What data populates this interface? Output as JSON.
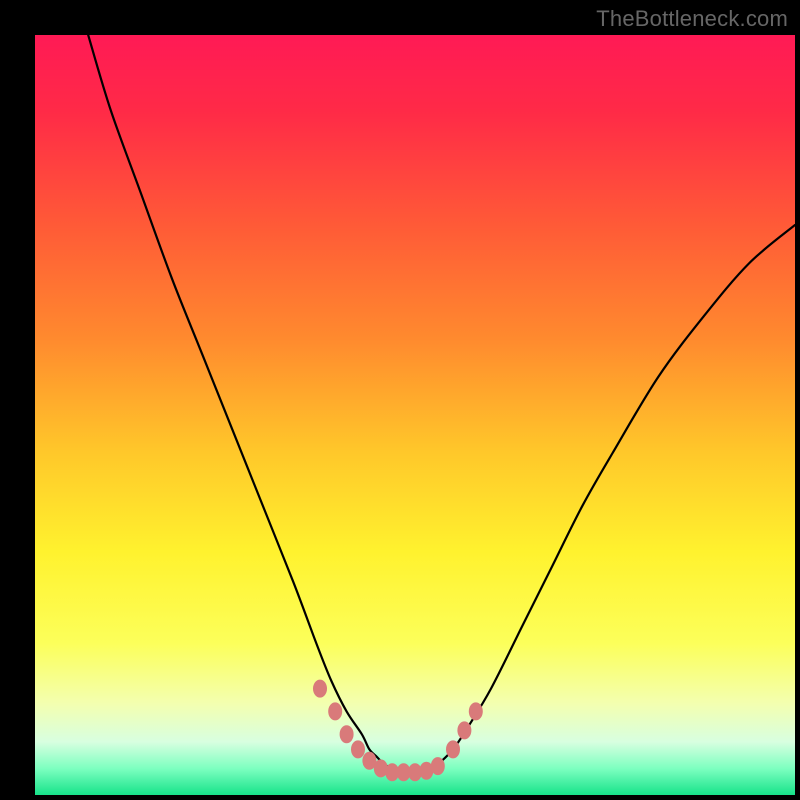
{
  "watermark": "TheBottleneck.com",
  "chart_data": {
    "type": "line",
    "title": "",
    "xlabel": "",
    "ylabel": "",
    "xlim": [
      0,
      100
    ],
    "ylim": [
      0,
      100
    ],
    "grid": false,
    "legend": false,
    "background_gradient_stops": [
      {
        "offset": 0.0,
        "color": "#ff1a55"
      },
      {
        "offset": 0.1,
        "color": "#ff2a47"
      },
      {
        "offset": 0.25,
        "color": "#ff5a37"
      },
      {
        "offset": 0.4,
        "color": "#ff8a2e"
      },
      {
        "offset": 0.55,
        "color": "#ffc82a"
      },
      {
        "offset": 0.68,
        "color": "#fff22e"
      },
      {
        "offset": 0.8,
        "color": "#fcff5a"
      },
      {
        "offset": 0.88,
        "color": "#f3ffb0"
      },
      {
        "offset": 0.93,
        "color": "#d8ffe0"
      },
      {
        "offset": 0.965,
        "color": "#7dffc0"
      },
      {
        "offset": 1.0,
        "color": "#17e38a"
      }
    ],
    "series": [
      {
        "name": "bottleneck-curve",
        "color": "#000000",
        "x": [
          7,
          10,
          14,
          18,
          22,
          26,
          30,
          34,
          37,
          39,
          41,
          43,
          44,
          45,
          46,
          48,
          50,
          52,
          53,
          55,
          57,
          60,
          64,
          68,
          72,
          76,
          82,
          88,
          94,
          100
        ],
        "y": [
          100,
          90,
          79,
          68,
          58,
          48,
          38,
          28,
          20,
          15,
          11,
          8,
          6,
          5,
          4,
          3,
          3,
          3,
          4,
          6,
          9,
          14,
          22,
          30,
          38,
          45,
          55,
          63,
          70,
          75
        ]
      },
      {
        "name": "valley-markers",
        "type": "scatter",
        "color": "#d97a7a",
        "x": [
          37.5,
          39.5,
          41.0,
          42.5,
          44.0,
          45.5,
          47.0,
          48.5,
          50.0,
          51.5,
          53.0,
          55.0,
          56.5,
          58.0
        ],
        "y": [
          14,
          11,
          8,
          6,
          4.5,
          3.5,
          3,
          3,
          3,
          3.2,
          3.8,
          6,
          8.5,
          11
        ]
      }
    ],
    "annotations": []
  }
}
